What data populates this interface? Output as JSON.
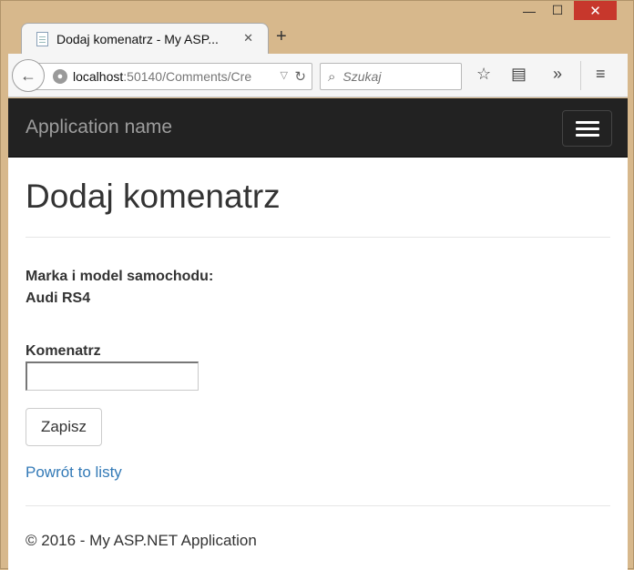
{
  "window": {
    "minimize_glyph": "—",
    "maximize_glyph": "☐",
    "close_glyph": "✕"
  },
  "browser": {
    "tab_title": "Dodaj komenatrz - My ASP...",
    "tab_close": "✕",
    "new_tab": "+",
    "url_host": "localhost",
    "url_path": ":50140/Comments/Cre",
    "search_placeholder": "Szukaj",
    "icons": [
      "back-arrow-icon",
      "globe-icon",
      "dropdown-icon",
      "reload-icon",
      "search-icon",
      "bookmark-star-icon",
      "reading-list-icon",
      "overflow-chevron-icon",
      "menu-icon"
    ]
  },
  "navbar": {
    "brand": "Application name"
  },
  "page": {
    "title": "Dodaj komenatrz",
    "car_label": "Marka i model samochodu:",
    "car_value": "Audi RS4",
    "comment_label": "Komenatrz",
    "comment_value": "",
    "submit_label": "Zapisz",
    "back_link": "Powrót to listy",
    "footer": "© 2016 - My ASP.NET Application"
  },
  "colors": {
    "navbar_bg": "#222222",
    "link": "#337ab7",
    "close_button": "#c7372c"
  }
}
